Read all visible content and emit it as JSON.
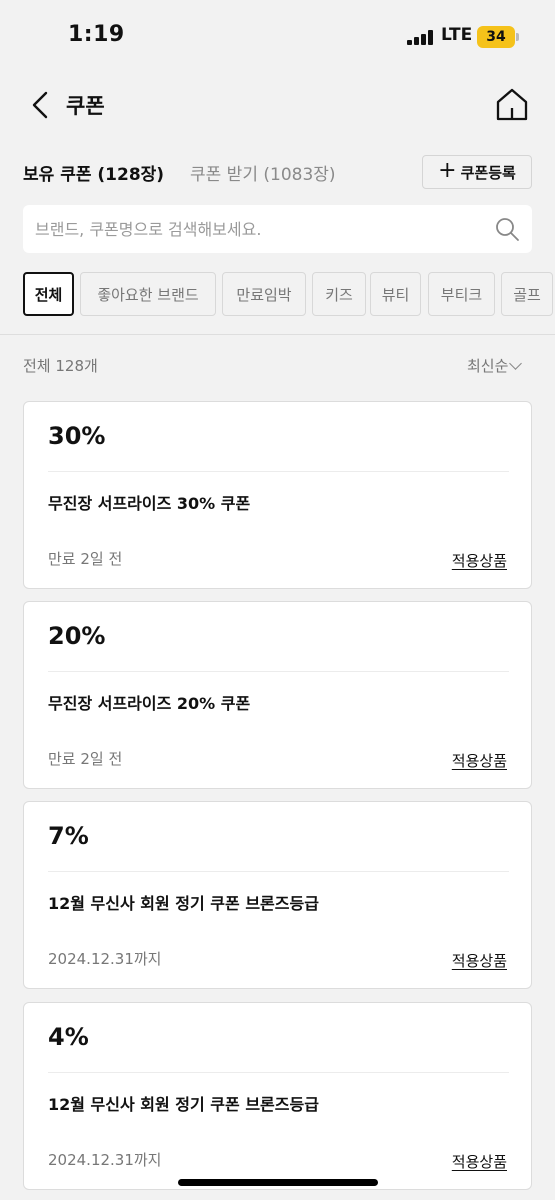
{
  "status_bar": {
    "time": "1:19",
    "network": "LTE",
    "battery": "34",
    "battery_color": "#f5c21a"
  },
  "nav": {
    "back_icon": "chevron-left-icon",
    "title": "쿠폰",
    "home_icon": "home-icon"
  },
  "tabs": {
    "held": "보유 쿠폰 (128장)",
    "get": "쿠폰 받기 (1083장)"
  },
  "register_button": {
    "icon": "+",
    "label": "쿠폰등록"
  },
  "search": {
    "placeholder": "브랜드, 쿠폰명으로 검색해보세요.",
    "value": "",
    "icon": "search-icon"
  },
  "filters": [
    {
      "label": "전체",
      "active": true
    },
    {
      "label": "좋아요한 브랜드",
      "active": false
    },
    {
      "label": "만료임박",
      "active": false
    },
    {
      "label": "키즈",
      "active": false
    },
    {
      "label": "뷰티",
      "active": false
    },
    {
      "label": "부티크",
      "active": false
    },
    {
      "label": "골프",
      "active": false
    }
  ],
  "list_header": {
    "count": "전체 128개",
    "sort": "최신순"
  },
  "coupons": [
    {
      "discount": "30%",
      "name": "무진장 서프라이즈 30% 쿠폰",
      "expiry": "만료 2일 전",
      "link": "적용상품"
    },
    {
      "discount": "20%",
      "name": "무진장 서프라이즈 20% 쿠폰",
      "expiry": "만료 2일 전",
      "link": "적용상품"
    },
    {
      "discount": "7%",
      "name": "12월 무신사 회원 정기 쿠폰 브론즈등급",
      "expiry": "2024.12.31까지",
      "link": "적용상품"
    },
    {
      "discount": "4%",
      "name": "12월 무신사 회원 정기 쿠폰 브론즈등급",
      "expiry": "2024.12.31까지",
      "link": "적용상품"
    }
  ]
}
